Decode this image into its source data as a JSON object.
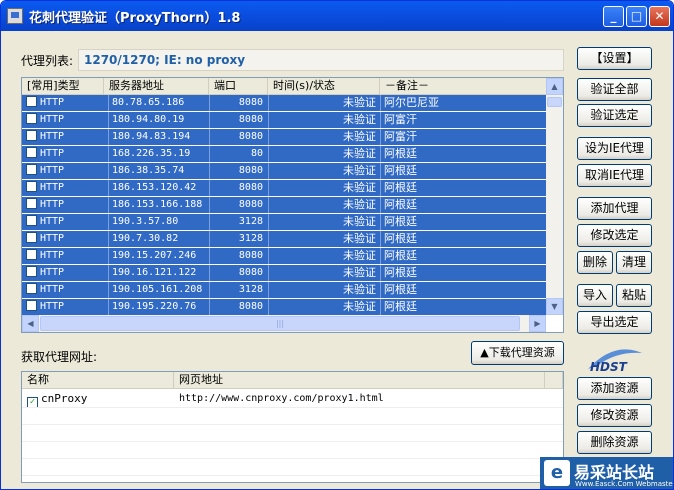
{
  "window": {
    "title": "花刺代理验证（ProxyThorn）1.8",
    "controls": {
      "minimize": "_",
      "maximize": "□",
      "close": "✕"
    }
  },
  "proxy_list": {
    "label": "代理列表:",
    "status": "1270/1270;   IE: no proxy",
    "columns": [
      "[常用]类型",
      "服务器地址",
      "端口",
      "时间(s)/状态",
      "－备注－"
    ],
    "rows": [
      {
        "type": "HTTP",
        "ip": "80.78.65.186",
        "port": "8080",
        "status": "未验证",
        "note": "阿尔巴尼亚"
      },
      {
        "type": "HTTP",
        "ip": "180.94.80.19",
        "port": "8080",
        "status": "未验证",
        "note": "阿富汗"
      },
      {
        "type": "HTTP",
        "ip": "180.94.83.194",
        "port": "8080",
        "status": "未验证",
        "note": "阿富汗"
      },
      {
        "type": "HTTP",
        "ip": "168.226.35.19",
        "port": "80",
        "status": "未验证",
        "note": "阿根廷"
      },
      {
        "type": "HTTP",
        "ip": "186.38.35.74",
        "port": "8080",
        "status": "未验证",
        "note": "阿根廷"
      },
      {
        "type": "HTTP",
        "ip": "186.153.120.42",
        "port": "8080",
        "status": "未验证",
        "note": "阿根廷"
      },
      {
        "type": "HTTP",
        "ip": "186.153.166.188",
        "port": "8080",
        "status": "未验证",
        "note": "阿根廷"
      },
      {
        "type": "HTTP",
        "ip": "190.3.57.80",
        "port": "3128",
        "status": "未验证",
        "note": "阿根廷"
      },
      {
        "type": "HTTP",
        "ip": "190.7.30.82",
        "port": "3128",
        "status": "未验证",
        "note": "阿根廷"
      },
      {
        "type": "HTTP",
        "ip": "190.15.207.246",
        "port": "8080",
        "status": "未验证",
        "note": "阿根廷"
      },
      {
        "type": "HTTP",
        "ip": "190.16.121.122",
        "port": "8080",
        "status": "未验证",
        "note": "阿根廷"
      },
      {
        "type": "HTTP",
        "ip": "190.105.161.208",
        "port": "3128",
        "status": "未验证",
        "note": "阿根廷"
      },
      {
        "type": "HTTP",
        "ip": "190.195.220.76",
        "port": "8080",
        "status": "未验证",
        "note": "阿根廷"
      }
    ]
  },
  "buttons": {
    "settings": "【设置】",
    "verify_all": "验证全部",
    "verify_selected": "验证选定",
    "set_ie_proxy": "设为IE代理",
    "cancel_ie_proxy": "取消IE代理",
    "add_proxy": "添加代理",
    "edit_selected": "修改选定",
    "delete": "删除",
    "clear": "清理",
    "import": "导入",
    "paste": "粘贴",
    "export_selected": "导出选定",
    "add_source": "添加资源",
    "edit_source": "修改资源",
    "delete_source": "删除资源"
  },
  "fetch": {
    "label": "获取代理网址:",
    "download_button": "▲下载代理资源",
    "columns": [
      "名称",
      "网页地址"
    ],
    "rows": [
      {
        "name": "cnProxy",
        "url": "http://www.cnproxy.com/proxy1.html",
        "checked": "✓"
      }
    ]
  },
  "logo": {
    "text": "HDST"
  },
  "watermark": {
    "icon_letter": "e",
    "text": "易采站长站",
    "sub": "Www.Easck.Com Webmaster"
  },
  "colors": {
    "titlebar": "#0a4ee0",
    "selection": "#316ac5",
    "status_text": "#2060a8",
    "watermark_bg": "#1f5fa7"
  }
}
